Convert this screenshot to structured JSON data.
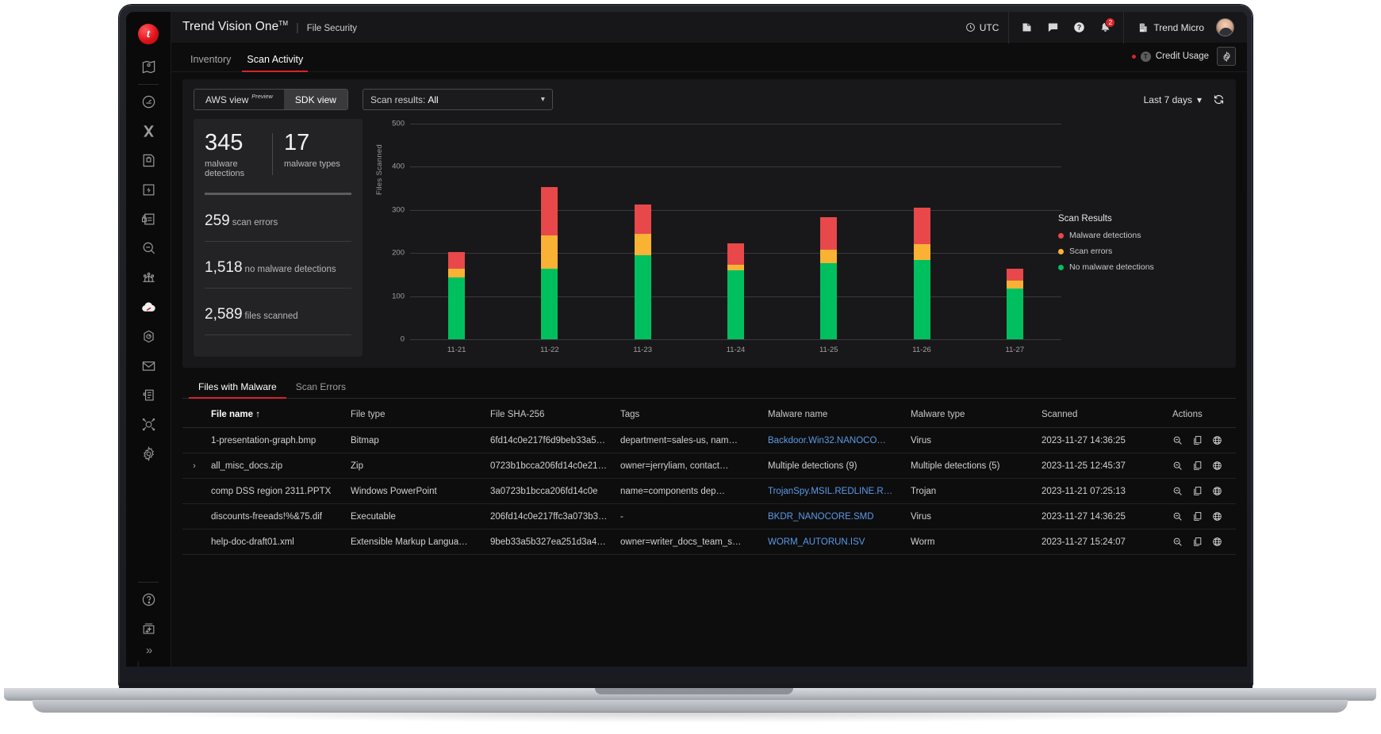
{
  "header": {
    "brand_title": "Trend Vision One",
    "brand_sup": "TM",
    "brand_sub": "File Security",
    "utc_label": "UTC",
    "org_name": "Trend Micro",
    "notification_count": "2",
    "icons": [
      "clock-icon",
      "book-icon",
      "chat-icon",
      "help-icon",
      "bell-icon",
      "building-icon",
      "avatar"
    ]
  },
  "tabs": {
    "items": [
      {
        "label": "Inventory",
        "active": false
      },
      {
        "label": "Scan Activity",
        "active": true
      }
    ],
    "credit_usage": "Credit Usage",
    "credit_coin": "T",
    "settings_icon": "gear-icon"
  },
  "toolbar": {
    "aws_view": "AWS view",
    "aws_view_sup": "Preview",
    "sdk_view": "SDK view",
    "scan_results_label": "Scan results:",
    "scan_results_value": "All",
    "scan_results_options": [
      "All"
    ],
    "time_range": "Last 7 days",
    "refresh_icon": "refresh-icon"
  },
  "stats": {
    "malware_detections_num": "345",
    "malware_detections_label": "malware detections",
    "malware_types_num": "17",
    "malware_types_label": "malware types",
    "rows": [
      {
        "num": "259",
        "label": "scan errors"
      },
      {
        "num": "1,518",
        "label": "no malware detections"
      },
      {
        "num": "2,589",
        "label": "files scanned"
      }
    ]
  },
  "chart_data": {
    "type": "bar",
    "stacked": true,
    "title": "",
    "xlabel": "",
    "ylabel": "Files Scanned",
    "ylim": [
      0,
      500
    ],
    "yticks": [
      0,
      100,
      200,
      300,
      400,
      500
    ],
    "grid": true,
    "legend_title": "Scan Results",
    "legend_position": "right",
    "categories": [
      "11-21",
      "11-22",
      "11-23",
      "11-24",
      "11-25",
      "11-26",
      "11-27"
    ],
    "series": [
      {
        "name": "No malware detections",
        "color": "#00bf5f",
        "values": [
          144,
          163,
          194,
          160,
          176,
          184,
          118
        ]
      },
      {
        "name": "Scan errors",
        "color": "#f9b233",
        "values": [
          20,
          78,
          50,
          13,
          32,
          37,
          18
        ]
      },
      {
        "name": "Malware detections",
        "color": "#e8484a",
        "values": [
          38,
          112,
          69,
          50,
          75,
          85,
          27
        ]
      }
    ],
    "totals": [
      202,
      353,
      313,
      223,
      283,
      306,
      163
    ]
  },
  "table_tabs": [
    {
      "label": "Files with Malware",
      "active": true
    },
    {
      "label": "Scan Errors",
      "active": false
    }
  ],
  "table": {
    "columns": [
      "File name ↑",
      "File type",
      "File SHA-256",
      "Tags",
      "Malware name",
      "Malware type",
      "Scanned",
      "Actions"
    ],
    "action_icons": [
      "search-icon",
      "copy-icon",
      "globe-icon"
    ],
    "rows": [
      {
        "expandable": false,
        "file_name": "1-presentation-graph.bmp",
        "file_type": "Bitmap",
        "sha256": "6fd14c0e217f6d9beb33a5…",
        "tags": "department=sales-us, nam…",
        "malware_name": "Backdoor.Win32.NANOCO…",
        "malware_name_link": true,
        "malware_type": "Virus",
        "scanned": "2023-11-27  14:36:25"
      },
      {
        "expandable": true,
        "file_name": "all_misc_docs.zip",
        "file_type": "Zip",
        "sha256": "0723b1bcca206fd14c0e21…",
        "tags": "owner=jerryliam, contact…",
        "malware_name": "Multiple detections (9)",
        "malware_name_link": false,
        "malware_type": "Multiple detections (5)",
        "scanned": "2023-11-25  12:45:37"
      },
      {
        "expandable": false,
        "file_name": "comp DSS region 2311.PPTX",
        "file_type": "Windows PowerPoint",
        "sha256": "3a0723b1bcca206fd14c0e",
        "tags": "name=components dep…",
        "malware_name": "TrojanSpy.MSIL.REDLINE.R…",
        "malware_name_link": true,
        "malware_type": "Trojan",
        "scanned": "2023-11-21  07:25:13"
      },
      {
        "expandable": false,
        "file_name": "discounts-freeads!%&75.dif",
        "file_type": "Executable",
        "sha256": "206fd14c0e217ffc3a073b3…",
        "tags": "-",
        "malware_name": "BKDR_NANOCORE.SMD",
        "malware_name_link": true,
        "malware_type": "Virus",
        "scanned": "2023-11-27  14:36:25"
      },
      {
        "expandable": false,
        "file_name": "help-doc-draft01.xml",
        "file_type": "Extensible Markup Langua…",
        "sha256": "9beb33a5b327ea251d3a4…",
        "tags": "owner=writer_docs_team_s…",
        "malware_name": "WORM_AUTORUN.ISV",
        "malware_name_link": true,
        "malware_type": "Worm",
        "scanned": "2023-11-27  15:24:07"
      }
    ]
  },
  "sidebar": {
    "items": [
      "location-pin-icon",
      "dashboard-gauge-icon",
      "xdr-icon",
      "threat-intel-icon",
      "zero-trust-icon",
      "secure-access-icon",
      "search-chat-icon",
      "workflow-icon",
      "cloud-security-icon",
      "endpoint-security-icon",
      "email-security-icon",
      "reports-icon",
      "attack-surface-icon",
      "administration-icon"
    ],
    "bottom_items": [
      "help-icon",
      "whats-new-icon"
    ],
    "expand_label": "»"
  },
  "colors": {
    "accent": "#d8232a",
    "malware": "#e8484a",
    "errors": "#f9b233",
    "clean": "#00bf5f",
    "link": "#5b9ae6"
  }
}
